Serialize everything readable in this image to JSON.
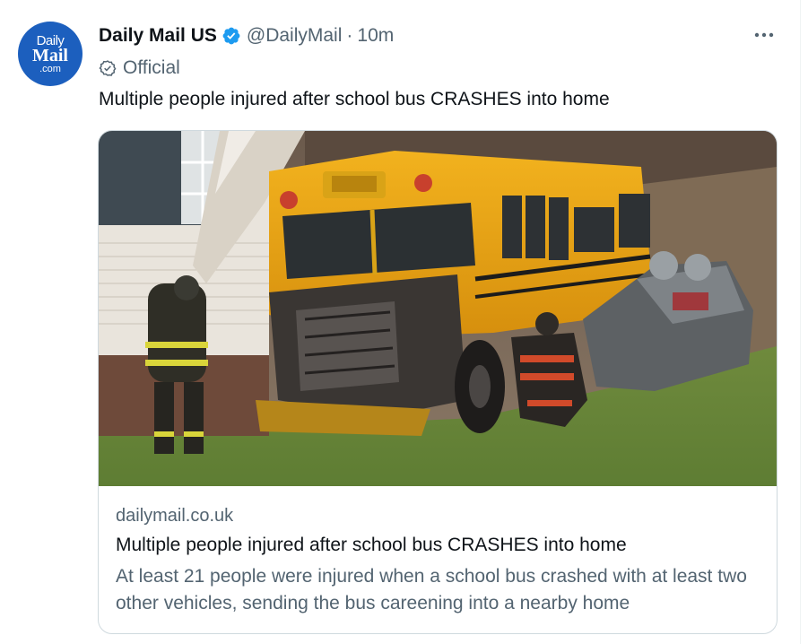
{
  "account": {
    "avatar_lines": [
      "Daily",
      "Mail",
      ".com"
    ],
    "display_name": "Daily Mail US",
    "handle": "@DailyMail",
    "separator": "·",
    "time": "10m",
    "label": "Official",
    "verified_color": "#1d9bf0"
  },
  "tweet": {
    "text": "Multiple people injured after school bus CRASHES into home"
  },
  "card": {
    "image_icon": "school-bus-crash-photo",
    "domain": "dailymail.co.uk",
    "title": "Multiple people injured after school bus CRASHES into home",
    "description": "At least 21 people were injured when a school bus crashed with at least two other vehicles, sending the bus careening into a nearby home"
  },
  "icons": {
    "more": "more-options-icon",
    "verified": "verified-badge-icon",
    "official": "official-badge-icon"
  }
}
